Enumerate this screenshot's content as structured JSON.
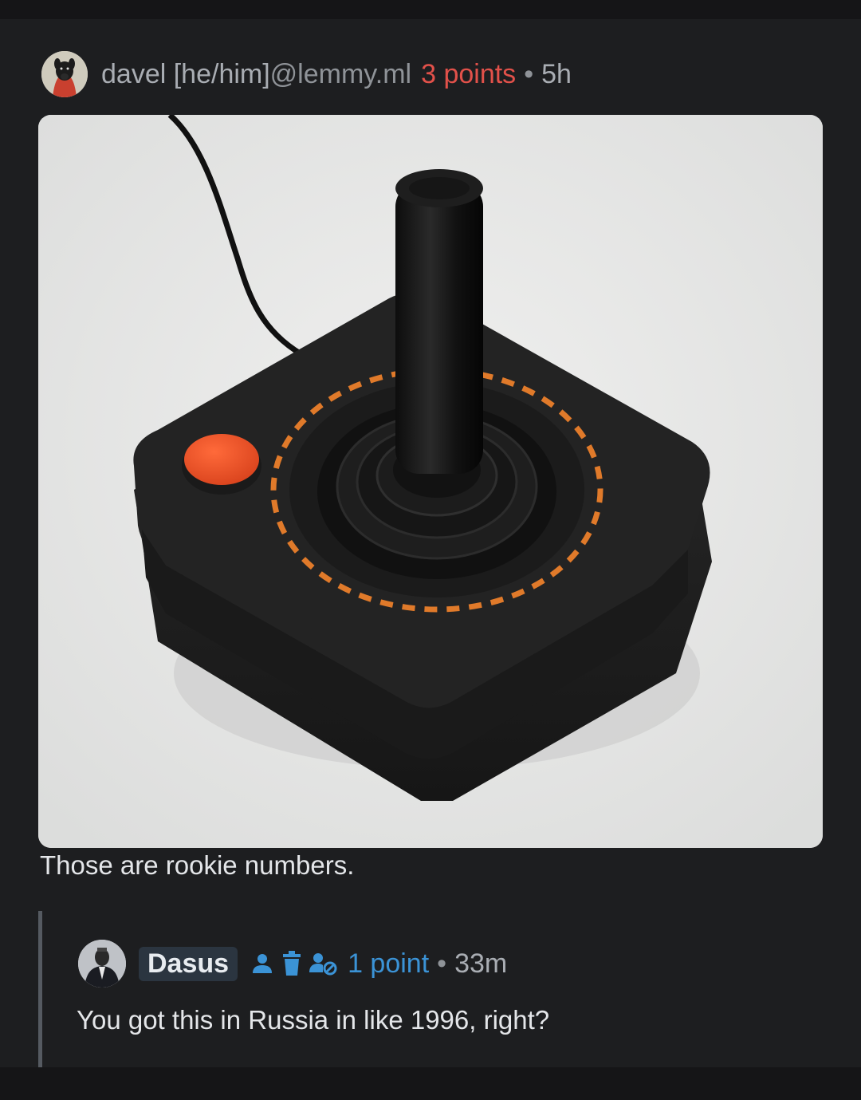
{
  "comment": {
    "username": "davel [he/him]",
    "instance": "@lemmy.ml",
    "score": "3 points",
    "separator": "•",
    "age": "5h",
    "body": "Those are rookie numbers."
  },
  "reply": {
    "username": "Dasus",
    "score": "1 point",
    "separator": "•",
    "age": "33m",
    "body": "You got this in Russia in like 1996, right?"
  },
  "icons": [
    "person-icon",
    "trash-icon",
    "person-blocked-icon"
  ],
  "colors": {
    "background": "#1d1e20",
    "score_red": "#e2514a",
    "score_blue": "#3b93d6",
    "badge_bg": "#2b3540"
  }
}
